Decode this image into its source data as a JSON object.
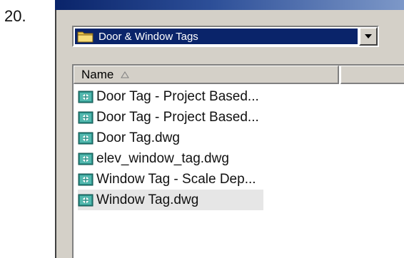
{
  "step_number": "20.",
  "folder_selector": {
    "icon": "folder-icon",
    "value": "Door & Window Tags",
    "dropdown_icon": "chevron-down-icon"
  },
  "column_header": {
    "name_label": "Name",
    "sort_icon": "sort-ascending-icon"
  },
  "files": [
    {
      "name": "Door Tag - Project Based...",
      "icon": "dwg-file-icon",
      "selected": false
    },
    {
      "name": "Door Tag - Project Based...",
      "icon": "dwg-file-icon",
      "selected": false
    },
    {
      "name": "Door Tag.dwg",
      "icon": "dwg-file-icon",
      "selected": false
    },
    {
      "name": "elev_window_tag.dwg",
      "icon": "dwg-file-icon",
      "selected": false
    },
    {
      "name": "Window Tag - Scale Dep...",
      "icon": "dwg-file-icon",
      "selected": false
    },
    {
      "name": "Window Tag.dwg",
      "icon": "dwg-file-icon",
      "selected": true
    }
  ],
  "colors": {
    "selection_highlight": "#0a246a",
    "window_face": "#d4d0c8",
    "file_icon_teal": "#2a8e86"
  }
}
